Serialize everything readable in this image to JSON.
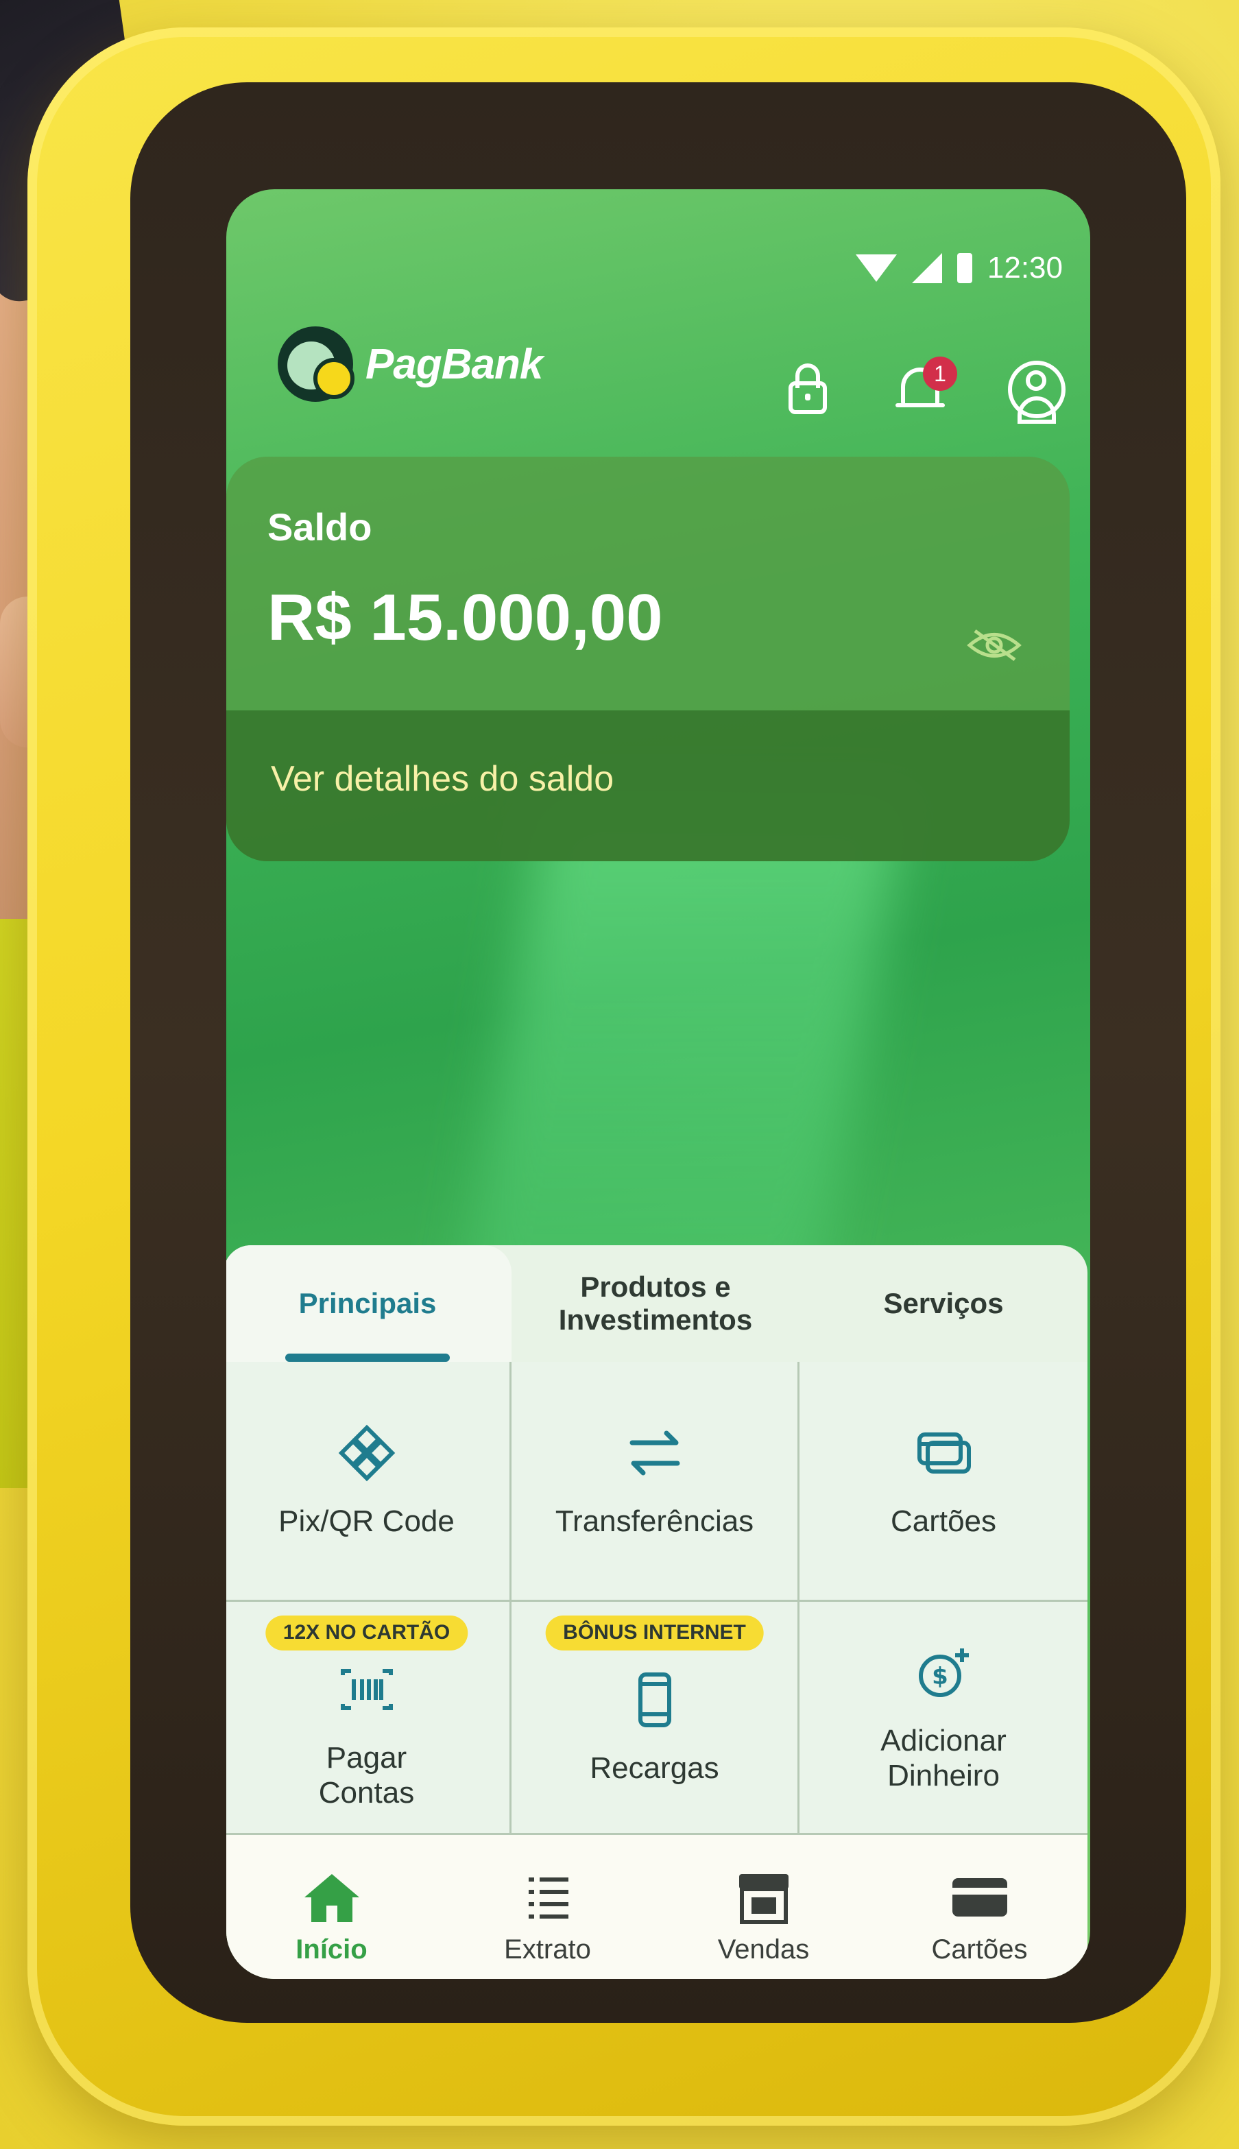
{
  "status_bar": {
    "time": "12:30"
  },
  "header": {
    "brand": "PagBank",
    "notification_count": "1"
  },
  "balance": {
    "label": "Saldo",
    "value": "R$ 15.000,00",
    "details_link": "Ver detalhes do saldo"
  },
  "tabs": [
    {
      "label": "Principais",
      "active": true
    },
    {
      "label": "Produtos e\nInvestimentos",
      "active": false
    },
    {
      "label": "Serviços",
      "active": false
    }
  ],
  "actions": [
    {
      "label": "Pix/QR Code",
      "icon": "pix-icon",
      "badge": ""
    },
    {
      "label": "Transferências",
      "icon": "transfer-arrows-icon",
      "badge": ""
    },
    {
      "label": "Cartões",
      "icon": "cards-icon",
      "badge": ""
    },
    {
      "label": "Pagar\nContas",
      "icon": "barcode-icon",
      "badge": "12X NO CARTÃO"
    },
    {
      "label": "Recargas",
      "icon": "phone-icon",
      "badge": "BÔNUS INTERNET"
    },
    {
      "label": "Adicionar\nDinheiro",
      "icon": "add-money-icon",
      "badge": ""
    }
  ],
  "bottom_nav": [
    {
      "label": "Início",
      "icon": "home-icon",
      "active": true
    },
    {
      "label": "Extrato",
      "icon": "list-icon",
      "active": false
    },
    {
      "label": "Vendas",
      "icon": "store-icon",
      "active": false
    },
    {
      "label": "Cartões",
      "icon": "card-icon",
      "active": false
    }
  ],
  "colors": {
    "background_yellow": "#f2e35a",
    "screen_green": "#3fb356",
    "accent_teal": "#1f7c8e",
    "badge_yellow": "#f7dc33",
    "notification_red": "#d22f4a",
    "nav_active_green": "#35a046"
  }
}
